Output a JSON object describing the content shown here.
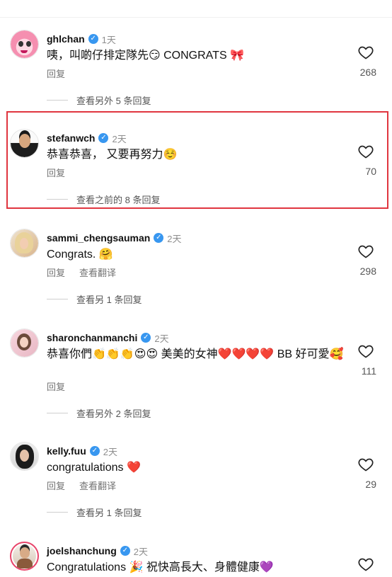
{
  "ui": {
    "reply_label": "回复",
    "translate_label": "查看翻译",
    "verified_mark": "✓"
  },
  "comments": [
    {
      "username": "ghlchan",
      "time": "1天",
      "text": "咦，叫啲仔排定隊先😏 CONGRATS 🎀",
      "likes": "268",
      "replies_label": "查看另外 5 条回复",
      "avatar_icon": "cartoon-pink-avatar"
    },
    {
      "username": "stefanwch",
      "time": "2天",
      "text": "恭喜恭喜， 又要再努力☺️",
      "likes": "70",
      "replies_label": "查看之前的 8 条回复",
      "avatar_icon": "man-photo-avatar"
    },
    {
      "username": "sammi_chengsauman",
      "time": "2天",
      "text": "Congrats. 🤗",
      "likes": "298",
      "replies_label": "查看另 1 条回复",
      "avatar_icon": "woman-photo-avatar"
    },
    {
      "username": "sharonchanmanchi",
      "time": "2天",
      "text": "恭喜你們👏👏👏😍😍 美美的女神❤️❤️❤️❤️ BB 好可愛🥰",
      "likes": "111",
      "replies_label": "查看另外 2 条回复",
      "avatar_icon": "woman-photo-avatar"
    },
    {
      "username": "kelly.fuu",
      "time": "2天",
      "text": "congratulations ❤️",
      "likes": "29",
      "replies_label": "查看另 1 条回复",
      "avatar_icon": "woman-photo-avatar"
    },
    {
      "username": "joelshanchung",
      "time": "2天",
      "text": "Congratulations 🎉 祝快高長大、身體健康💜",
      "likes": "",
      "replies_label": "",
      "avatar_icon": "man-photo-avatar"
    }
  ],
  "colors": {
    "highlight_border": "#e0353f",
    "verified": "#3897f0",
    "muted": "#8e8e8e"
  }
}
